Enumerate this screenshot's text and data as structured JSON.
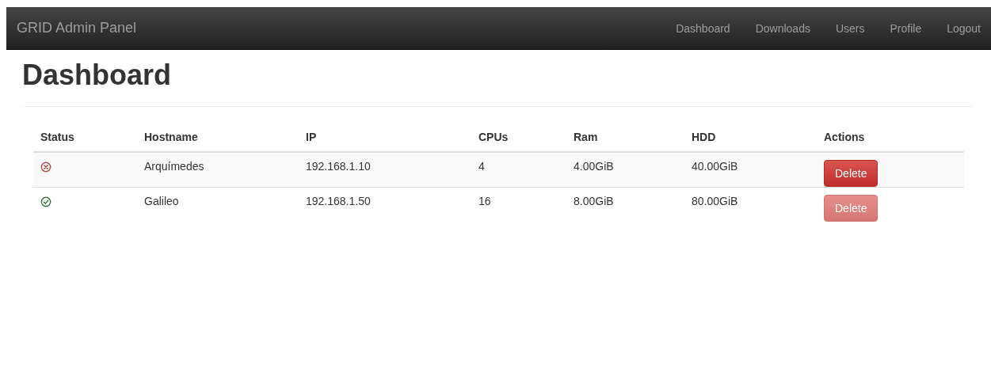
{
  "navbar": {
    "brand": "GRID Admin Panel",
    "links": [
      "Dashboard",
      "Downloads",
      "Users",
      "Profile",
      "Logout"
    ]
  },
  "page": {
    "title": "Dashboard"
  },
  "table": {
    "columns": [
      "Status",
      "Hostname",
      "IP",
      "CPUs",
      "Ram",
      "HDD",
      "Actions"
    ],
    "rows": [
      {
        "online": false,
        "hostname": "Arquímedes",
        "ip": "192.168.1.10",
        "cpus": "4",
        "ram": "4.00GiB",
        "hdd": "40.00GiB",
        "action": "Delete",
        "disabled": false
      },
      {
        "online": true,
        "hostname": "Galileo",
        "ip": "192.168.1.50",
        "cpus": "16",
        "ram": "8.00GiB",
        "hdd": "80.00GiB",
        "action": "Delete",
        "disabled": true
      }
    ]
  }
}
